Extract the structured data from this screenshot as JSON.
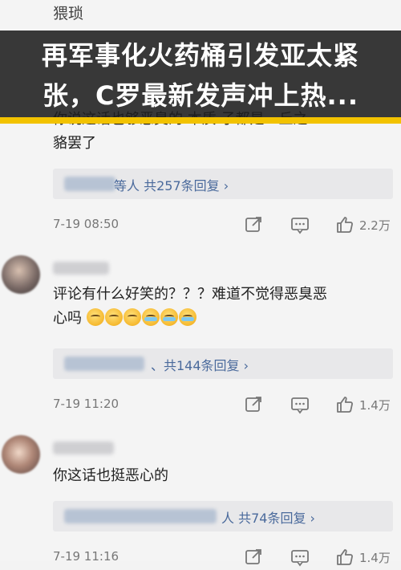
{
  "top_comment": {
    "text": "猥琐"
  },
  "banner": {
    "line1": "再军事化火药桶引发亚太紧",
    "line2": "张，C罗最新发声冲上热..."
  },
  "comment1": {
    "text_line1": "你说这话也够恶臭的 本质 子都是一丘之",
    "text_line2": "貉罢了",
    "replies_text": "等人  共257条回复 ›",
    "time": "7-19 08:50",
    "likes": "2.2万"
  },
  "comment2": {
    "text_line1": "评论有什么好笑的？？？难道不觉得恶臭恶",
    "text_line2": "心吗",
    "replies_text": "、共144条回复 ›",
    "time": "7-19 11:20",
    "likes": "1.4万"
  },
  "comment3": {
    "text_line1": "你这话也挺恶心的",
    "replies_text": "人  共74条回复 ›",
    "time": "7-19 11:16",
    "likes": "1.4万"
  },
  "icons": [
    "share-icon",
    "comment-icon",
    "like-icon"
  ]
}
